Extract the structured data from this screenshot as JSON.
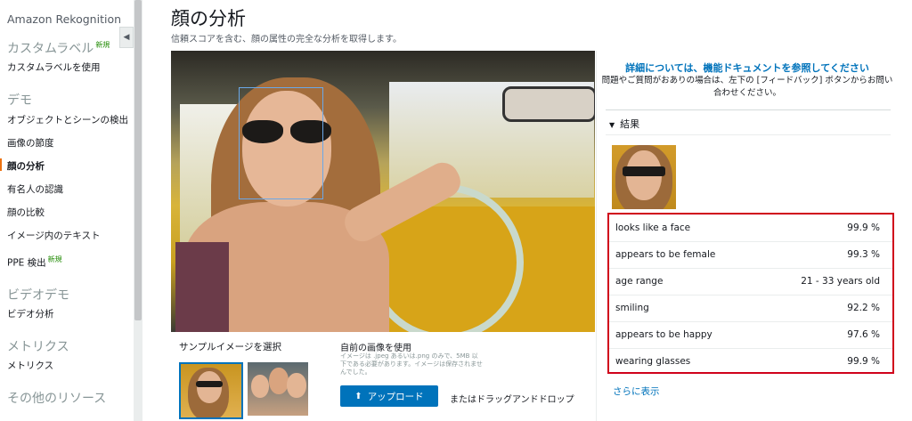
{
  "sidebar": {
    "title": "Amazon Rekognition",
    "sections": [
      {
        "heading": "カスタムラベル",
        "badge": "新規",
        "items": [
          "カスタムラベルを使用"
        ]
      },
      {
        "heading": "デモ",
        "items": [
          "オブジェクトとシーンの検出",
          "画像の節度",
          "顔の分析",
          "有名人の認識",
          "顔の比較",
          "イメージ内のテキスト",
          "PPE 検出"
        ],
        "ppe_badge": "新規"
      },
      {
        "heading": "ビデオデモ",
        "items": [
          "ビデオ分析"
        ]
      },
      {
        "heading": "メトリクス",
        "items": [
          "メトリクス"
        ]
      },
      {
        "heading": "その他のリソース",
        "items": []
      }
    ],
    "active_item": "顔の分析",
    "collapse_icon": "chevron-left-icon"
  },
  "header": {
    "title": "顔の分析",
    "subtitle": "信頼スコアを含む、顔の属性の完全な分析を取得します。"
  },
  "samples": {
    "label": "サンプルイメージを選択"
  },
  "upload": {
    "label": "自前の画像を使用",
    "note": "イメージは .jpeg あるいは.png のみで、5MB 以下である必要があります。イメージは保存されませんでした。",
    "button_label": "アップロード",
    "button_icon": "upload-icon",
    "drop_text": "またはドラッグアンドドロップ"
  },
  "panel": {
    "doc_link": "詳細については、機能ドキュメントを参照してください",
    "help_text": "問題やご質問がおありの場合は、左下の [フィードバック] ボタンからお問い合わせください。",
    "results_heading": "結果",
    "results": [
      {
        "label": "looks like a face",
        "value": "99.9 %"
      },
      {
        "label": "appears to be female",
        "value": "99.3 %"
      },
      {
        "label": "age range",
        "value": "21 - 33 years old"
      },
      {
        "label": "smiling",
        "value": "92.2 %"
      },
      {
        "label": "appears to be happy",
        "value": "97.6 %"
      },
      {
        "label": "wearing glasses",
        "value": "99.9 %"
      }
    ],
    "more_link": "さらに表示"
  },
  "colors": {
    "accent": "#0073bb",
    "highlight_border": "#d0021b",
    "active_indicator": "#ec7211"
  }
}
